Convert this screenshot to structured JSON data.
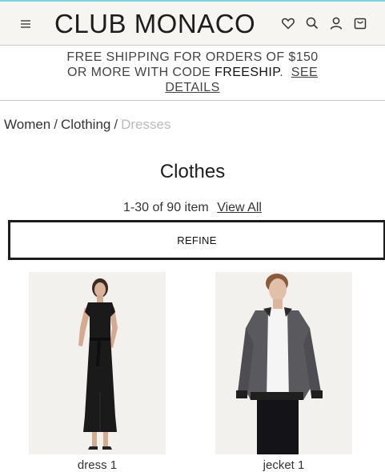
{
  "header": {
    "logo": "CLUB MONACO",
    "icons": [
      "menu-icon",
      "heart-icon",
      "search-icon",
      "user-icon",
      "bag-icon"
    ]
  },
  "promo": {
    "line1": "FREE SHIPPING FOR ORDERS OF $150",
    "line2_prefix": "OR MORE WITH CODE ",
    "code": "FREESHIP",
    "line2_suffix": ".",
    "link1": "SEE",
    "link2": "DETAILS"
  },
  "breadcrumb": {
    "items": [
      "Women",
      "Clothing"
    ],
    "current": "Dresses",
    "separator": "/"
  },
  "page_title": "Clothes",
  "results": {
    "count_text": "1-30 of 90 item",
    "view_all": "View All"
  },
  "refine_label": "REFINE",
  "products": [
    {
      "name": "dress 1"
    },
    {
      "name": "jecket 1"
    }
  ],
  "colors": {
    "accent_line": "#7fd3dc",
    "header_bg": "#f7f5f2",
    "text": "#222222"
  }
}
